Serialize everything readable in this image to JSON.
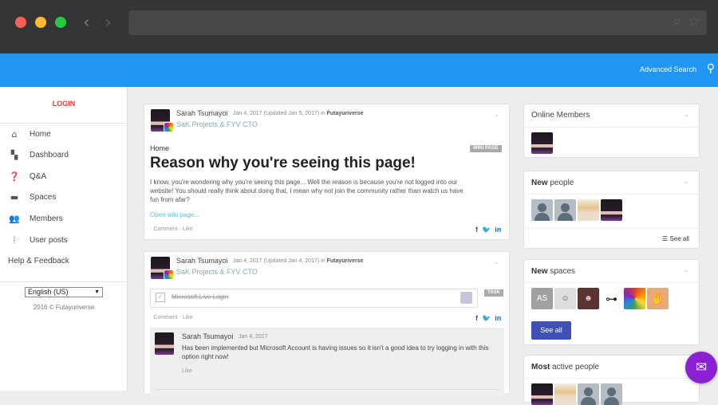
{
  "browser": {
    "back_icon": "chevron-left-icon",
    "forward_icon": "chevron-right-icon",
    "search_icon": "magnifier-icon",
    "star_icon": "star-icon",
    "colors": {
      "close": "#fe5f57",
      "minimize": "#febc2e",
      "maximize": "#28c840"
    }
  },
  "topbar": {
    "advanced_search": "Advanced Search",
    "color": "#2196f3"
  },
  "sidebar": {
    "login": "LOGIN",
    "items": [
      {
        "label": "Home",
        "icon": "home-icon"
      },
      {
        "label": "Dashboard",
        "icon": "dashboard-icon"
      },
      {
        "label": "Q&A",
        "icon": "question-icon"
      },
      {
        "label": "Spaces",
        "icon": "inbox-icon"
      },
      {
        "label": "Members",
        "icon": "people-icon"
      },
      {
        "label": "User posts",
        "icon": "waveform-icon"
      }
    ],
    "help": "Help & Feedback",
    "language": "English (US)",
    "copyright": "2016 © Futayuriverse"
  },
  "posts": [
    {
      "author": "Sarah Tsumayoi",
      "date": "Jan 4, 2017 (Updated Jan 5, 2017)",
      "in_word": "in",
      "space": "Futayuriverse",
      "subtitle": "SaK Projects & FYV CTO",
      "tag": "WIKI PAGE",
      "breadcrumb": "Home",
      "title": "Reason why you're seeing this page!",
      "body": "I know, you're wondering why you're seeing this page... Well the reason is because you're not logged into our website! You should really think about doing that, I mean why not join the community rather than watch us have fun from afar?",
      "open_link": "Open wiki page...",
      "actions": "· Comment · Like"
    },
    {
      "author": "Sarah Tsumayoi",
      "date": "Jan 4, 2017 (Updated Jan 4, 2017)",
      "in_word": "in",
      "space": "Futayuriverse",
      "subtitle": "SaK Projects & FYV CTO",
      "tag": "TASK",
      "task_title": "Microsoft Live Login",
      "actions": "· Comment · Like",
      "comment": {
        "author": "Sarah Tsumayoi",
        "date": "Jan 4, 2017",
        "text": "Has been implemented but Microsoft Account is having issues so it isn't a good idea to try logging in with this option right now!",
        "like": "Like"
      }
    }
  ],
  "widgets": {
    "online": {
      "title": "Online Members"
    },
    "new_people": {
      "title_bold": "New",
      "title_rest": " people",
      "see_all": "See all"
    },
    "new_spaces": {
      "title_bold": "New",
      "title_rest": " spaces",
      "first_initials": "AS",
      "see_all": "See all"
    },
    "active": {
      "title_bold": "Most",
      "title_rest": " active people"
    }
  }
}
